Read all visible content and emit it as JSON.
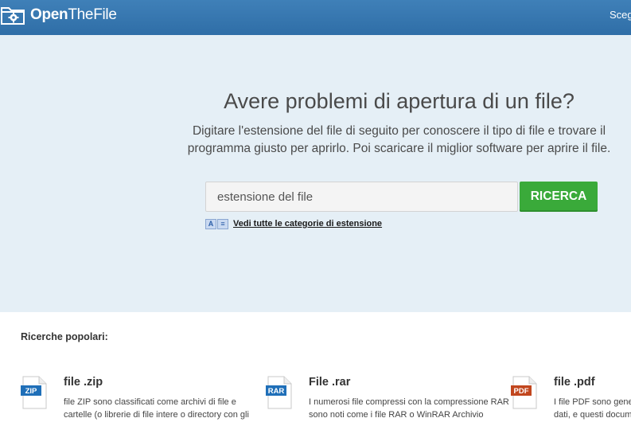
{
  "header": {
    "logo_bold": "Open",
    "logo_light": "TheFile",
    "right_link": "Scegli"
  },
  "hero": {
    "title": "Avere problemi di apertura di un file?",
    "subtitle_line1": "Digitare l'estensione del file di seguito per conoscere il tipo di file e trovare il",
    "subtitle_line2": "programma giusto per aprirlo. Poi scaricare il miglior software per aprire il file."
  },
  "search": {
    "placeholder": "estensione del file",
    "button_label": "RICERCA",
    "category_icon_a": "A",
    "category_icon_list": "≡",
    "categories_link": "Vedi tutte le categorie di estensione"
  },
  "popular": {
    "title": "Ricerche popolari:",
    "items": [
      {
        "badge": "ZIP",
        "badge_color": "#1f6fb8",
        "title": "file .zip",
        "desc_line1": "file ZIP sono classificati come archivi di file e",
        "desc_line2": "cartelle (o librerie di file intere o directory con gli"
      },
      {
        "badge": "RAR",
        "badge_color": "#1f6fb8",
        "title": "File .rar",
        "desc_line1": "I numerosi file compressi con la compressione RAR",
        "desc_line2": "sono noti come i file RAR o WinRAR Archivio"
      },
      {
        "badge": "PDF",
        "badge_color": "#c1461e",
        "title": "file .pdf",
        "desc_line1": "I file PDF sono gene",
        "desc_line2": "dati, e questi docum"
      }
    ]
  }
}
